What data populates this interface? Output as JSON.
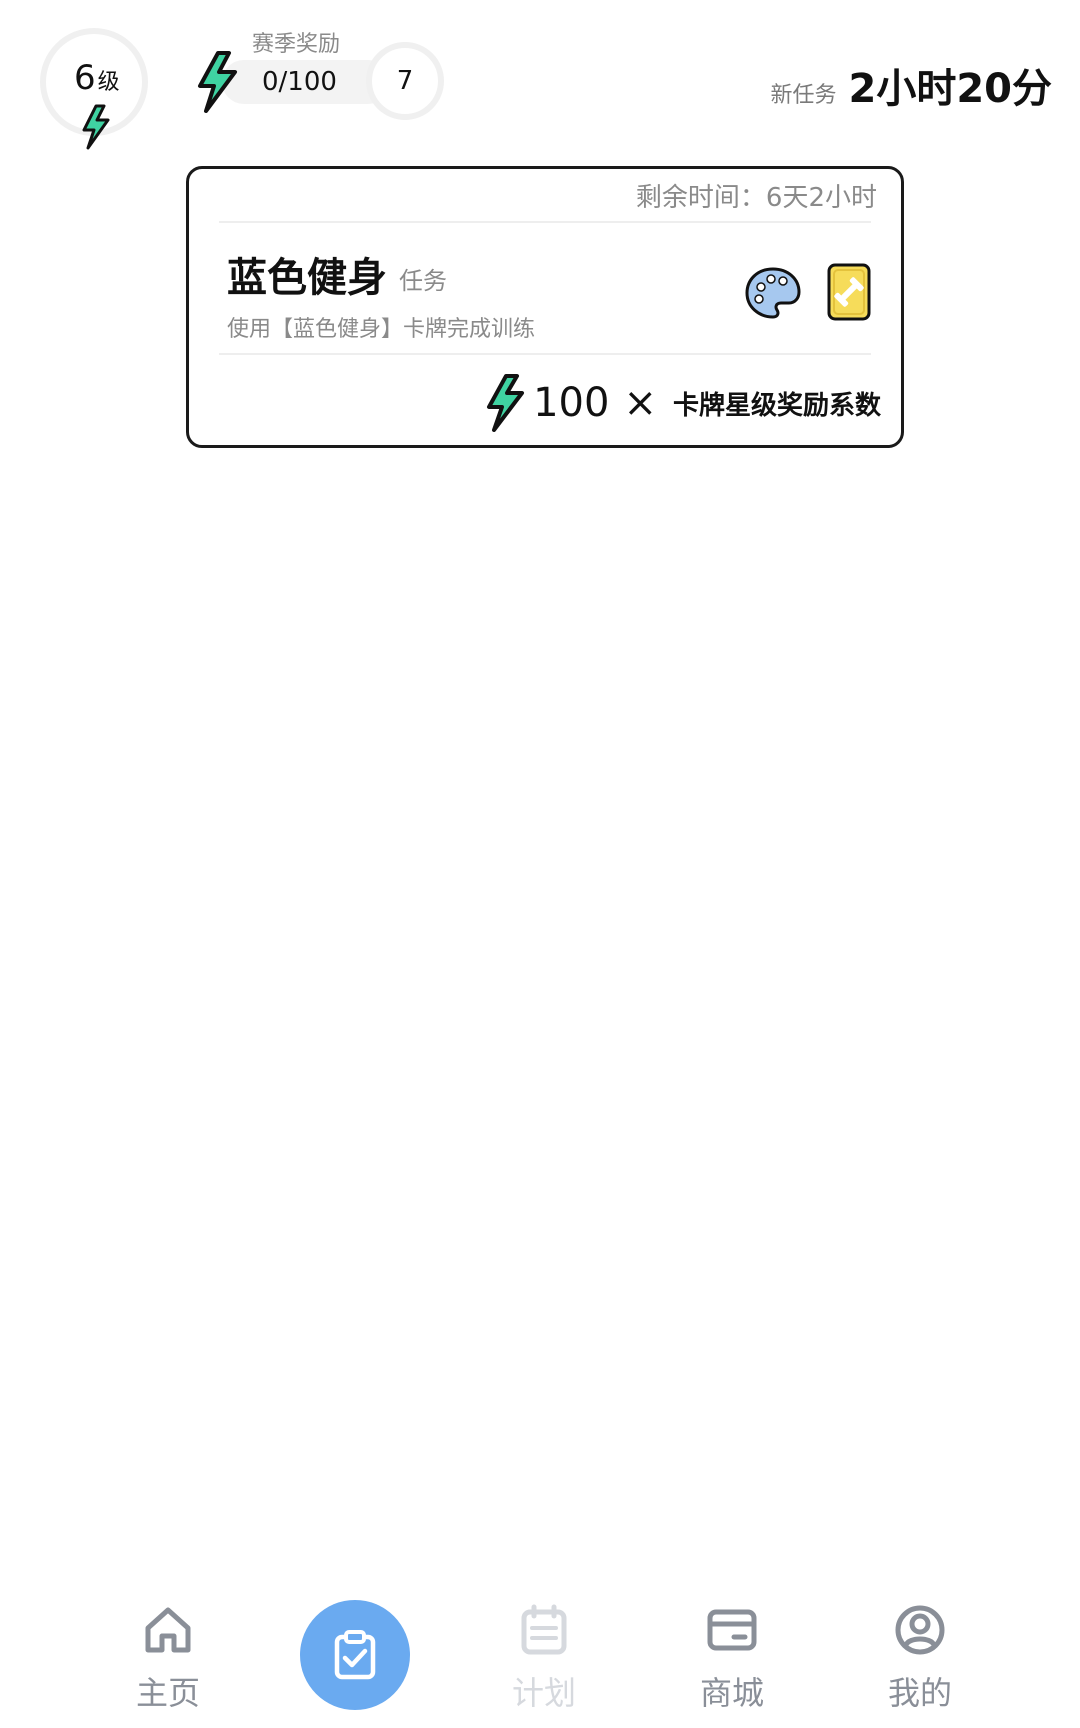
{
  "header": {
    "level": "6",
    "level_unit": "级",
    "season": {
      "label": "赛季奖励",
      "progress": "0/100",
      "next_level": "7"
    },
    "new_task": {
      "label": "新任务",
      "time": "2小时20分"
    }
  },
  "task_card": {
    "remaining": "剩余时间：6天2小时",
    "title": "蓝色健身",
    "tag": "任务",
    "description": "使用【蓝色健身】卡牌完成训练",
    "reward": {
      "amount": "100",
      "multiplier": "×",
      "factor_label": "卡牌星级奖励系数"
    }
  },
  "bottom_nav": {
    "items": [
      {
        "label": "主页",
        "icon": "home-icon"
      },
      {
        "label": "",
        "icon": "clipboard-check-icon"
      },
      {
        "label": "计划",
        "icon": "calendar-icon"
      },
      {
        "label": "商城",
        "icon": "card-icon"
      },
      {
        "label": "我的",
        "icon": "user-icon"
      }
    ]
  },
  "colors": {
    "bolt_green": "#3fd3a2",
    "nav_active_bg": "#6aaaf0",
    "nav_gray": "#8a8f98",
    "nav_disabled": "#d6d9de",
    "card_yellow": "#f6dc5a",
    "palette_blue": "#a6c8ef"
  }
}
